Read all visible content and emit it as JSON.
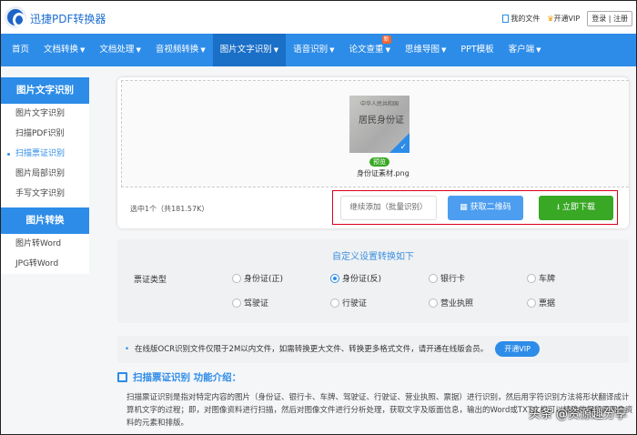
{
  "header": {
    "brand": "迅捷PDF转换器",
    "my_files": "我的文件",
    "vip": "开通VIP",
    "login": "登录",
    "sep": "|",
    "register": "注册"
  },
  "nav": [
    {
      "label": "首页",
      "caret": false
    },
    {
      "label": "文档转换",
      "caret": true
    },
    {
      "label": "文档处理",
      "caret": true
    },
    {
      "label": "音视频转换",
      "caret": true
    },
    {
      "label": "图片文字识别",
      "caret": true,
      "active": true
    },
    {
      "label": "语音识别",
      "caret": true
    },
    {
      "label": "论文查重",
      "caret": true,
      "badge": "新"
    },
    {
      "label": "思维导图",
      "caret": true
    },
    {
      "label": "PPT模板",
      "caret": false
    },
    {
      "label": "客户端",
      "caret": true
    }
  ],
  "sidebar": {
    "section1": "图片文字识别",
    "items1": [
      "图片文字识别",
      "扫描PDF识别",
      "扫描票证识别",
      "图片局部识别",
      "手写文字识别"
    ],
    "section2": "图片转换",
    "items2": [
      "图片转Word",
      "JPG转Word"
    ]
  },
  "upload": {
    "thumb_line1": "中华人民共和国",
    "thumb_line2": "居民身份证",
    "preview": "预览",
    "filename": "身份证素材.png",
    "selected": "选中1个（共181.57K）",
    "add_more": "继续添加（批量识别）",
    "qr": "获取二维码",
    "download": "立即下载"
  },
  "settings": {
    "title": "自定义设置转换如下",
    "label": "票证类型",
    "options": [
      "身份证(正)",
      "身份证(反)",
      "银行卡",
      "车牌",
      "驾驶证",
      "行驶证",
      "营业执照",
      "票据"
    ],
    "selected_index": 1
  },
  "notice": {
    "text": "在线版OCR识别文件仅限于2M以内文件，如需转换更大文件、转换更多格式文件，请开通在线版会员。",
    "button": "开通VIP"
  },
  "intro": {
    "title": "扫描票证识别 功能介绍：",
    "body": "扫描票证识别是指对特定内容的图片（身份证、银行卡、车牌、驾驶证、行驶证、营业执照、票据）进行识别，然后用字符识别方法将形状翻译成计算机文字的过程；即，对图像资料进行扫描，然后对图像文件进行分析处理，获取文字及版面信息，输出的Word或TXT文档可以精确的保留原图像资料的元素和排版。"
  },
  "watermark": "头条 @资源趣分享",
  "colors": {
    "primary": "#2d8ce8",
    "green": "#38a825",
    "red": "#d9001b"
  }
}
